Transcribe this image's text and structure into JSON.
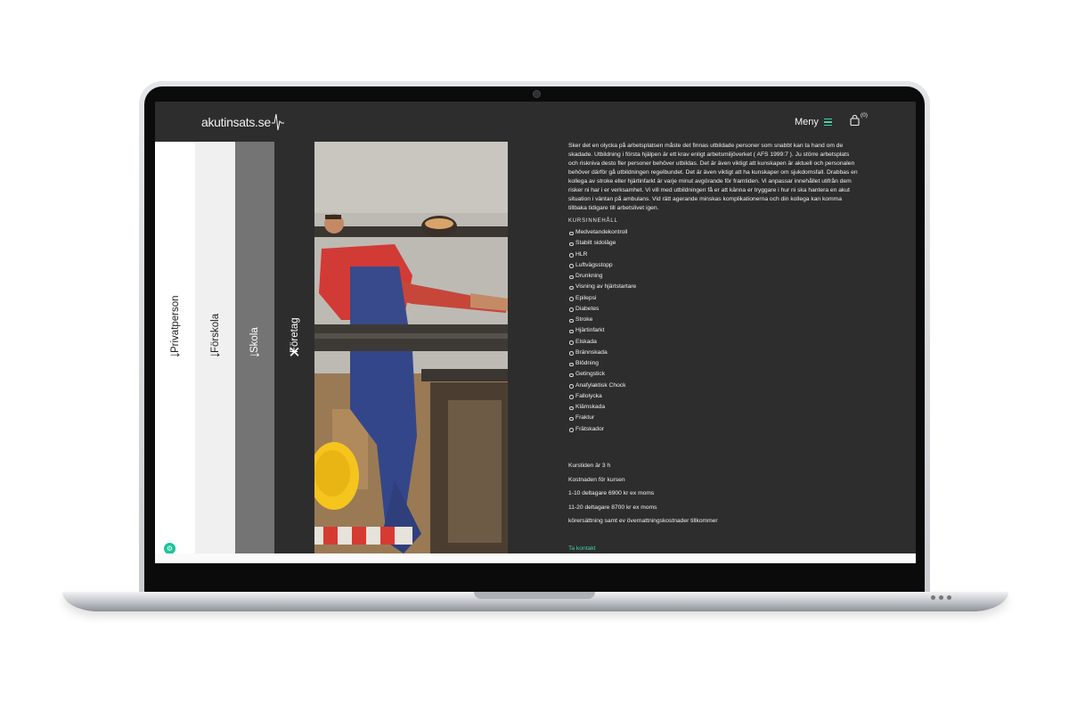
{
  "header": {
    "logo_text": "akutinsats.se",
    "menu_label": "Meny",
    "cart_count": "(0)",
    "accent_color": "#3fd3a7"
  },
  "tabs": [
    {
      "label": "Privatperson",
      "icon": "arrow-right-icon"
    },
    {
      "label": "Förskola",
      "icon": "arrow-right-icon"
    },
    {
      "label": "Skola",
      "icon": "arrow-right-icon"
    },
    {
      "label": "Företag",
      "icon": "close-icon"
    }
  ],
  "content": {
    "intro": "Sker det en olycka på arbetsplatsen måste det finnas utbildade personer som snabbt kan ta hand om de skadade. Utbildning i första hjälpen är ett krav enligt arbetsmiljöverket ( AFS 1999:7 ). Ju större arbetsplats och riskniva desto fler personer behöver utbildas. Det är även viktigt att kunskapen är aktuell och personalen behöver därför gå utbildningen regelbundet. Det är även viktigt att ha kunskaper om sjukdomsfall. Drabbas en kollega av stroke eller hjärtinfarkt är varje minut avgörande för framtiden. Vi anpassar innehållet utifrån dem risker ni har i er verksamhet. Vi vill med utbildningen få er att känna er tryggare i hur ni ska hantera en akut situation i väntan på ambulans. Vid rätt agerande minskas komplikationerna och din kollega kan komma tillbaka tidigare till arbetslivet igen.",
    "course_heading": "KURSINNEHÅLL",
    "course_items": [
      "Medvetandekontroll",
      "Stabilt sidoläge",
      "HLR",
      "Luftvägsstopp",
      "Drunkning",
      "Visning av hjärtstartare",
      "Epilepsi",
      "Diabetes",
      "Stroke",
      "Hjärtinfarkt",
      "Elskada",
      "Brännskada",
      "Blödning",
      "Getingstick",
      "Anafylaktisk Chock",
      "Fallolycka",
      "Klämskada",
      "Fraktur",
      "Frätskador"
    ],
    "duration": "Kurstiden är 3 h",
    "cost_heading": "Kostnaden för kursen",
    "price_1": "1-10 deltagare  6900 kr ex moms",
    "price_2": "11-20 deltagare 8700 kr ex moms",
    "travel_note": "körersättning samt ev övernattningskostnader tillkommer",
    "contact_link": "Ta kontakt"
  }
}
